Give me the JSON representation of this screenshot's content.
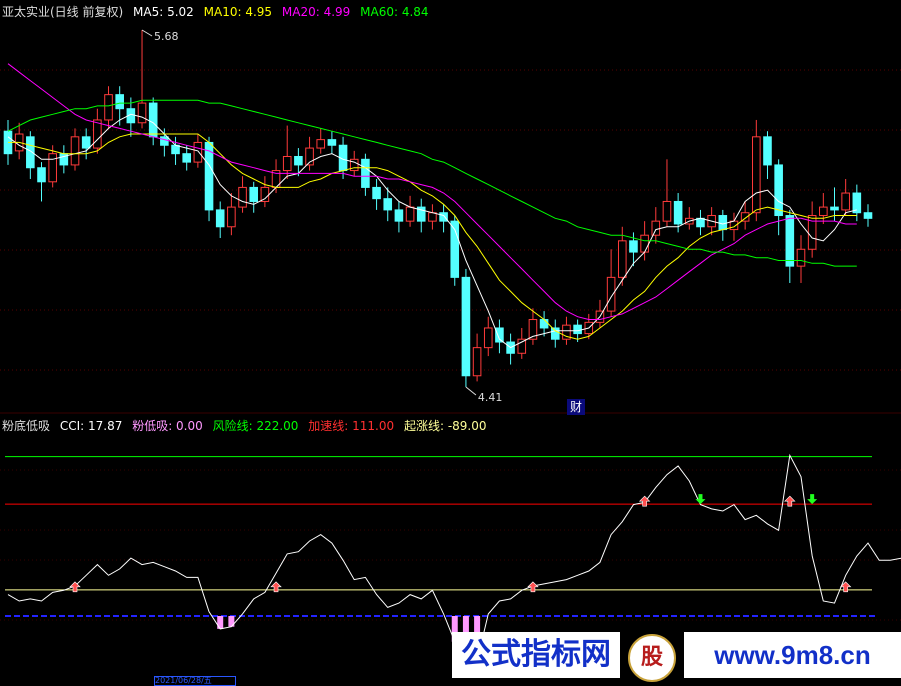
{
  "header": {
    "title": "亚太实业(日线 前复权)",
    "ma5": "MA5: 5.02",
    "ma10": "MA10: 4.95",
    "ma20": "MA20: 4.99",
    "ma60": "MA60: 4.84"
  },
  "price_labels": {
    "high": "5.68",
    "low": "4.41"
  },
  "badge": "财",
  "indicator": {
    "name": "粉底低吸",
    "cci": "CCI: 17.87",
    "fen": "粉低吸: 0.00",
    "risk": "风险线: 222.00",
    "accel": "加速线: 111.00",
    "rise": "起涨线: -89.00"
  },
  "watermark": {
    "left": "公式指标网",
    "logo": "股",
    "right": "www.9m8.cn"
  },
  "date_fragment": "2021/06/28/五",
  "colors": {
    "up": "#ff3b3b",
    "down": "#54ffff",
    "ma5": "#ffffff",
    "ma10": "#ffff00",
    "ma20": "#ff00ff",
    "ma60": "#00ff00",
    "cci": "#ffffff",
    "risk": "#00ff00",
    "accel": "#ff0000",
    "rise": "#ffff99",
    "baseline": "#2323ff",
    "fen": "#ff99ff"
  },
  "chart_data": [
    {
      "type": "candlestick",
      "title": "亚太实业(日线 前复权)",
      "y_annotations": {
        "max": 5.68,
        "min": 4.41
      },
      "candles": [
        {
          "o": 5.32,
          "c": 5.24,
          "h": 5.36,
          "l": 5.2
        },
        {
          "o": 5.25,
          "c": 5.31,
          "h": 5.35,
          "l": 5.22
        },
        {
          "o": 5.3,
          "c": 5.19,
          "h": 5.32,
          "l": 5.15
        },
        {
          "o": 5.19,
          "c": 5.14,
          "h": 5.21,
          "l": 5.07
        },
        {
          "o": 5.14,
          "c": 5.24,
          "h": 5.27,
          "l": 5.12
        },
        {
          "o": 5.24,
          "c": 5.2,
          "h": 5.27,
          "l": 5.17
        },
        {
          "o": 5.2,
          "c": 5.3,
          "h": 5.33,
          "l": 5.18
        },
        {
          "o": 5.3,
          "c": 5.26,
          "h": 5.33,
          "l": 5.22
        },
        {
          "o": 5.26,
          "c": 5.36,
          "h": 5.4,
          "l": 5.24
        },
        {
          "o": 5.36,
          "c": 5.45,
          "h": 5.48,
          "l": 5.33
        },
        {
          "o": 5.45,
          "c": 5.4,
          "h": 5.48,
          "l": 5.34
        },
        {
          "o": 5.4,
          "c": 5.35,
          "h": 5.44,
          "l": 5.3
        },
        {
          "o": 5.35,
          "c": 5.42,
          "h": 5.68,
          "l": 5.33
        },
        {
          "o": 5.42,
          "c": 5.3,
          "h": 5.44,
          "l": 5.27
        },
        {
          "o": 5.3,
          "c": 5.27,
          "h": 5.33,
          "l": 5.23
        },
        {
          "o": 5.27,
          "c": 5.24,
          "h": 5.3,
          "l": 5.2
        },
        {
          "o": 5.24,
          "c": 5.21,
          "h": 5.27,
          "l": 5.18
        },
        {
          "o": 5.21,
          "c": 5.28,
          "h": 5.31,
          "l": 5.19
        },
        {
          "o": 5.28,
          "c": 5.04,
          "h": 5.3,
          "l": 5.0
        },
        {
          "o": 5.04,
          "c": 4.98,
          "h": 5.07,
          "l": 4.94
        },
        {
          "o": 4.98,
          "c": 5.05,
          "h": 5.1,
          "l": 4.95
        },
        {
          "o": 5.05,
          "c": 5.12,
          "h": 5.16,
          "l": 5.03
        },
        {
          "o": 5.12,
          "c": 5.07,
          "h": 5.14,
          "l": 5.03
        },
        {
          "o": 5.07,
          "c": 5.12,
          "h": 5.16,
          "l": 5.05
        },
        {
          "o": 5.12,
          "c": 5.18,
          "h": 5.22,
          "l": 5.1
        },
        {
          "o": 5.18,
          "c": 5.23,
          "h": 5.34,
          "l": 5.15
        },
        {
          "o": 5.23,
          "c": 5.2,
          "h": 5.26,
          "l": 5.16
        },
        {
          "o": 5.2,
          "c": 5.26,
          "h": 5.3,
          "l": 5.18
        },
        {
          "o": 5.26,
          "c": 5.29,
          "h": 5.33,
          "l": 5.24
        },
        {
          "o": 5.29,
          "c": 5.27,
          "h": 5.32,
          "l": 5.24
        },
        {
          "o": 5.27,
          "c": 5.18,
          "h": 5.3,
          "l": 5.15
        },
        {
          "o": 5.18,
          "c": 5.22,
          "h": 5.25,
          "l": 5.16
        },
        {
          "o": 5.22,
          "c": 5.12,
          "h": 5.24,
          "l": 5.09
        },
        {
          "o": 5.12,
          "c": 5.08,
          "h": 5.15,
          "l": 5.04
        },
        {
          "o": 5.08,
          "c": 5.04,
          "h": 5.12,
          "l": 5.0
        },
        {
          "o": 5.04,
          "c": 5.0,
          "h": 5.07,
          "l": 4.96
        },
        {
          "o": 5.0,
          "c": 5.05,
          "h": 5.09,
          "l": 4.98
        },
        {
          "o": 5.05,
          "c": 5.0,
          "h": 5.08,
          "l": 4.96
        },
        {
          "o": 5.0,
          "c": 5.03,
          "h": 5.06,
          "l": 4.97
        },
        {
          "o": 5.03,
          "c": 5.0,
          "h": 5.06,
          "l": 4.96
        },
        {
          "o": 5.0,
          "c": 4.8,
          "h": 5.02,
          "l": 4.77
        },
        {
          "o": 4.8,
          "c": 4.45,
          "h": 4.83,
          "l": 4.41
        },
        {
          "o": 4.45,
          "c": 4.55,
          "h": 4.6,
          "l": 4.43
        },
        {
          "o": 4.55,
          "c": 4.62,
          "h": 4.66,
          "l": 4.52
        },
        {
          "o": 4.62,
          "c": 4.57,
          "h": 4.65,
          "l": 4.53
        },
        {
          "o": 4.57,
          "c": 4.53,
          "h": 4.6,
          "l": 4.49
        },
        {
          "o": 4.53,
          "c": 4.58,
          "h": 4.62,
          "l": 4.51
        },
        {
          "o": 4.58,
          "c": 4.65,
          "h": 4.69,
          "l": 4.56
        },
        {
          "o": 4.65,
          "c": 4.62,
          "h": 4.68,
          "l": 4.59
        },
        {
          "o": 4.62,
          "c": 4.58,
          "h": 4.65,
          "l": 4.55
        },
        {
          "o": 4.58,
          "c": 4.63,
          "h": 4.66,
          "l": 4.56
        },
        {
          "o": 4.63,
          "c": 4.6,
          "h": 4.65,
          "l": 4.57
        },
        {
          "o": 4.6,
          "c": 4.64,
          "h": 4.67,
          "l": 4.58
        },
        {
          "o": 4.64,
          "c": 4.68,
          "h": 4.72,
          "l": 4.62
        },
        {
          "o": 4.68,
          "c": 4.8,
          "h": 4.9,
          "l": 4.66
        },
        {
          "o": 4.8,
          "c": 4.93,
          "h": 4.98,
          "l": 4.77
        },
        {
          "o": 4.93,
          "c": 4.89,
          "h": 4.96,
          "l": 4.84
        },
        {
          "o": 4.89,
          "c": 4.95,
          "h": 5.0,
          "l": 4.86
        },
        {
          "o": 4.95,
          "c": 5.0,
          "h": 5.05,
          "l": 4.92
        },
        {
          "o": 5.0,
          "c": 5.07,
          "h": 5.22,
          "l": 4.98
        },
        {
          "o": 5.07,
          "c": 4.99,
          "h": 5.1,
          "l": 4.96
        },
        {
          "o": 4.99,
          "c": 5.01,
          "h": 5.05,
          "l": 4.97
        },
        {
          "o": 5.01,
          "c": 4.98,
          "h": 5.04,
          "l": 4.95
        },
        {
          "o": 4.98,
          "c": 5.02,
          "h": 5.05,
          "l": 4.95
        },
        {
          "o": 5.02,
          "c": 4.97,
          "h": 5.04,
          "l": 4.93
        },
        {
          "o": 4.97,
          "c": 5.0,
          "h": 5.03,
          "l": 4.93
        },
        {
          "o": 5.0,
          "c": 5.03,
          "h": 5.07,
          "l": 4.97
        },
        {
          "o": 5.03,
          "c": 5.3,
          "h": 5.36,
          "l": 5.0
        },
        {
          "o": 5.3,
          "c": 5.2,
          "h": 5.32,
          "l": 5.15
        },
        {
          "o": 5.2,
          "c": 5.02,
          "h": 5.22,
          "l": 4.95
        },
        {
          "o": 5.02,
          "c": 4.84,
          "h": 5.04,
          "l": 4.78
        },
        {
          "o": 4.84,
          "c": 4.9,
          "h": 4.95,
          "l": 4.78
        },
        {
          "o": 4.9,
          "c": 5.02,
          "h": 5.07,
          "l": 4.87
        },
        {
          "o": 5.02,
          "c": 5.05,
          "h": 5.1,
          "l": 4.99
        },
        {
          "o": 5.05,
          "c": 5.04,
          "h": 5.12,
          "l": 5.0
        },
        {
          "o": 5.04,
          "c": 5.1,
          "h": 5.15,
          "l": 5.02
        },
        {
          "o": 5.1,
          "c": 5.03,
          "h": 5.13,
          "l": 5.0
        },
        {
          "o": 5.03,
          "c": 5.01,
          "h": 5.06,
          "l": 4.98
        }
      ],
      "series": [
        {
          "name": "MA5",
          "values": [
            5.3,
            5.27,
            5.25,
            5.22,
            5.22,
            5.23,
            5.24,
            5.25,
            5.29,
            5.33,
            5.36,
            5.38,
            5.37,
            5.35,
            5.31,
            5.27,
            5.26,
            5.25,
            5.2,
            5.13,
            5.09,
            5.07,
            5.06,
            5.08,
            5.12,
            5.16,
            5.17,
            5.21,
            5.23,
            5.24,
            5.22,
            5.21,
            5.19,
            5.16,
            5.11,
            5.07,
            5.05,
            5.04,
            5.03,
            5.02,
            4.97,
            4.86,
            4.77,
            4.68,
            4.58,
            4.55,
            4.57,
            4.59,
            4.6,
            4.61,
            4.61,
            4.61,
            4.62,
            4.66,
            4.73,
            4.79,
            4.85,
            4.89,
            4.97,
            4.98,
            4.98,
            5.0,
            5.01,
            5.0,
            4.99,
            5.0,
            5.07,
            5.1,
            5.11,
            5.07,
            5.05,
            4.99,
            4.94,
            4.93,
            4.97,
            5.03,
            5.04
          ]
        },
        {
          "name": "MA10",
          "values": [
            5.28,
            5.28,
            5.27,
            5.26,
            5.25,
            5.24,
            5.24,
            5.24,
            5.25,
            5.28,
            5.3,
            5.31,
            5.31,
            5.31,
            5.31,
            5.31,
            5.31,
            5.31,
            5.28,
            5.24,
            5.2,
            5.17,
            5.15,
            5.13,
            5.12,
            5.12,
            5.12,
            5.14,
            5.15,
            5.17,
            5.18,
            5.19,
            5.19,
            5.19,
            5.18,
            5.16,
            5.14,
            5.11,
            5.09,
            5.06,
            5.02,
            4.96,
            4.91,
            4.85,
            4.79,
            4.75,
            4.71,
            4.68,
            4.65,
            4.61,
            4.59,
            4.58,
            4.59,
            4.62,
            4.65,
            4.68,
            4.72,
            4.75,
            4.8,
            4.84,
            4.87,
            4.91,
            4.94,
            4.96,
            4.97,
            4.98,
            5.01,
            5.04,
            5.05,
            5.04,
            5.03,
            5.02,
            5.01,
            5.01,
            5.02,
            5.02,
            5.02
          ]
        },
        {
          "name": "MA20",
          "values": [
            5.56,
            5.53,
            5.5,
            5.47,
            5.44,
            5.41,
            5.38,
            5.36,
            5.35,
            5.34,
            5.33,
            5.32,
            5.31,
            5.3,
            5.29,
            5.28,
            5.27,
            5.26,
            5.25,
            5.23,
            5.21,
            5.2,
            5.19,
            5.18,
            5.17,
            5.17,
            5.17,
            5.17,
            5.17,
            5.17,
            5.17,
            5.16,
            5.16,
            5.16,
            5.15,
            5.15,
            5.14,
            5.13,
            5.12,
            5.1,
            5.07,
            5.03,
            4.99,
            4.95,
            4.91,
            4.87,
            4.83,
            4.79,
            4.75,
            4.71,
            4.68,
            4.66,
            4.65,
            4.65,
            4.66,
            4.67,
            4.69,
            4.71,
            4.73,
            4.76,
            4.79,
            4.82,
            4.85,
            4.88,
            4.9,
            4.92,
            4.95,
            4.97,
            4.99,
            5.0,
            5.01,
            5.01,
            5.0,
            5.0,
            5.0,
            4.99,
            4.99
          ]
        },
        {
          "name": "MA60",
          "values": [
            5.32,
            5.34,
            5.36,
            5.37,
            5.38,
            5.39,
            5.4,
            5.4,
            5.41,
            5.41,
            5.42,
            5.42,
            5.43,
            5.43,
            5.43,
            5.43,
            5.43,
            5.43,
            5.42,
            5.42,
            5.41,
            5.4,
            5.39,
            5.38,
            5.37,
            5.36,
            5.35,
            5.34,
            5.33,
            5.32,
            5.31,
            5.3,
            5.29,
            5.28,
            5.27,
            5.26,
            5.25,
            5.24,
            5.22,
            5.21,
            5.19,
            5.17,
            5.15,
            5.13,
            5.11,
            5.09,
            5.07,
            5.05,
            5.03,
            5.01,
            5.0,
            4.98,
            4.97,
            4.96,
            4.95,
            4.95,
            4.94,
            4.93,
            4.93,
            4.92,
            4.91,
            4.9,
            4.9,
            4.89,
            4.89,
            4.88,
            4.88,
            4.87,
            4.87,
            4.86,
            4.86,
            4.86,
            4.85,
            4.85,
            4.84,
            4.84,
            4.84
          ]
        }
      ]
    },
    {
      "type": "line",
      "title": "粉底低吸",
      "series": [
        {
          "name": "CCI",
          "values": [
            -100,
            -115,
            -110,
            -115,
            -95,
            -90,
            -80,
            -55,
            -30,
            -55,
            -40,
            -15,
            -30,
            -25,
            -35,
            -45,
            -60,
            -60,
            -140,
            -180,
            -175,
            -145,
            -110,
            -95,
            -50,
            -5,
            0,
            25,
            40,
            20,
            -20,
            -65,
            -60,
            -100,
            -130,
            -120,
            -100,
            -110,
            -90,
            -145,
            -210,
            -280,
            -255,
            -145,
            -115,
            -110,
            -90,
            -80,
            -75,
            -70,
            -65,
            -55,
            -45,
            -25,
            40,
            70,
            110,
            115,
            150,
            180,
            200,
            165,
            110,
            100,
            95,
            110,
            75,
            85,
            65,
            50,
            225,
            175,
            -10,
            -115,
            -120,
            -55,
            -10,
            20,
            -20,
            -20,
            -15
          ]
        },
        {
          "name": "风险线",
          "values": [
            222
          ]
        },
        {
          "name": "加速线",
          "values": [
            111
          ]
        },
        {
          "name": "起涨线",
          "values": [
            -89
          ]
        }
      ]
    }
  ]
}
